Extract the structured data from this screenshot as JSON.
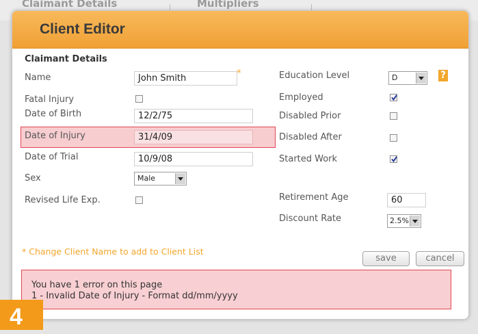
{
  "background": {
    "tabs": [
      {
        "label": "Claimant Details"
      },
      {
        "label": "Multipliers"
      }
    ]
  },
  "dialog": {
    "title": "Client Editor",
    "section_title": "Claimant Details",
    "left_fields": {
      "name_label": "Name",
      "name_value": "John Smith",
      "required_marker": "*",
      "fatal_injury_label": "Fatal Injury",
      "fatal_injury_checked": false,
      "dob_label": "Date of Birth",
      "dob_value": "12/2/75",
      "doi_label": "Date of Injury",
      "doi_value": "31/4/09",
      "dot_label": "Date of Trial",
      "dot_value": "10/9/08",
      "sex_label": "Sex",
      "sex_value": "Male",
      "revised_label": "Revised Life Exp.",
      "revised_checked": false
    },
    "right_fields": {
      "education_label": "Education Level",
      "education_value": "D",
      "help_icon": "?",
      "employed_label": "Employed",
      "employed_checked": true,
      "disabled_prior_label": "Disabled Prior",
      "disabled_prior_checked": false,
      "disabled_after_label": "Disabled After",
      "disabled_after_checked": false,
      "started_work_label": "Started Work",
      "started_work_checked": true,
      "retirement_label": "Retirement Age",
      "retirement_value": "60",
      "discount_label": "Discount Rate",
      "discount_value": "2.5%"
    },
    "note": "* Change Client Name to add to Client List",
    "buttons": {
      "save": "save",
      "cancel": "cancel"
    },
    "errors": {
      "summary": "You have 1 error on this page",
      "items": [
        "1 - Invalid Date of Injury - Format dd/mm/yyyy"
      ]
    }
  },
  "step_badge": "4",
  "colors": {
    "accent": "#f0a035",
    "error_border": "#e0454f",
    "error_fill": "#f8cfd2",
    "note": "#f2a62b"
  }
}
